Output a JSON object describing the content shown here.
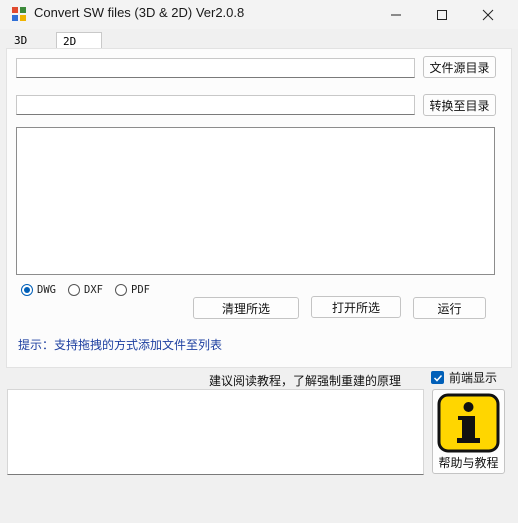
{
  "window": {
    "title": "Convert SW files (3D & 2D) Ver2.0.8",
    "minimize_glyph": "—",
    "maximize_glyph": "☐",
    "close_glyph": "✕"
  },
  "tabs": [
    {
      "label": "3D",
      "active": false
    },
    {
      "label": "2D",
      "active": true
    }
  ],
  "source": {
    "value": "",
    "button_label": "文件源目录"
  },
  "target": {
    "value": "",
    "button_label": "转换至目录"
  },
  "file_list": {
    "items": []
  },
  "formats": {
    "options": [
      {
        "label": "DWG",
        "checked": true
      },
      {
        "label": "DXF",
        "checked": false
      },
      {
        "label": "PDF",
        "checked": false
      }
    ]
  },
  "actions": {
    "clear_label": "清理所选",
    "open_label": "打开所选",
    "run_label": "运行"
  },
  "hint": "提示：支持拖拽的方式添加文件至列表",
  "recommend_text": "建议阅读教程，了解强制重建的原理",
  "topmost": {
    "label": "前端显示",
    "checked": true
  },
  "log": {
    "value": ""
  },
  "help": {
    "label": "帮助与教程",
    "icon_letter": "i"
  },
  "colors": {
    "accent": "#005fb8",
    "hint": "#1d3fa0",
    "help_icon_yellow": "#ffd600"
  }
}
